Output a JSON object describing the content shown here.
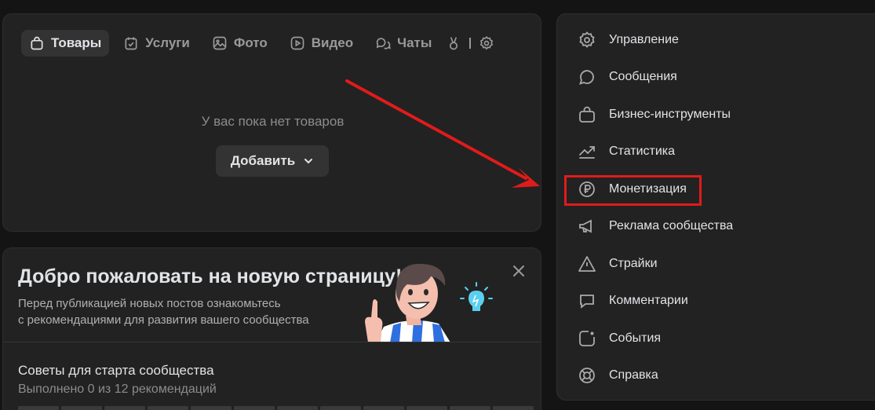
{
  "tabs": [
    {
      "label": "Товары",
      "icon": "bag-icon",
      "active": true
    },
    {
      "label": "Услуги",
      "icon": "calendar-check-icon"
    },
    {
      "label": "Фото",
      "icon": "image-icon"
    },
    {
      "label": "Видео",
      "icon": "play-icon"
    },
    {
      "label": "Чаты",
      "icon": "chats-icon"
    }
  ],
  "tabs_more": {
    "label": "l"
  },
  "products": {
    "empty_text": "У вас пока нет товаров",
    "add_label": "Добавить"
  },
  "welcome": {
    "title": "Добро пожаловать на новую страницу!",
    "desc_line1": "Перед публикацией новых постов ознакомьтесь",
    "desc_line2": "с рекомендациями для развития вашего сообщества",
    "tips_title": "Советы для старта сообщества",
    "tips_progress": "Выполнено 0 из 12 рекомендаций",
    "completed": 0,
    "total": 12
  },
  "menu": [
    {
      "label": "Управление",
      "icon": "gear-icon"
    },
    {
      "label": "Сообщения",
      "icon": "message-icon"
    },
    {
      "label": "Бизнес-инструменты",
      "icon": "briefcase-icon"
    },
    {
      "label": "Статистика",
      "icon": "trend-icon"
    },
    {
      "label": "Монетизация",
      "icon": "ruble-icon",
      "highlighted": true
    },
    {
      "label": "Реклама сообщества",
      "icon": "megaphone-icon"
    },
    {
      "label": "Страйки",
      "icon": "warning-icon"
    },
    {
      "label": "Комментарии",
      "icon": "comment-icon"
    },
    {
      "label": "События",
      "icon": "event-icon"
    },
    {
      "label": "Справка",
      "icon": "lifebuoy-icon"
    }
  ],
  "colors": {
    "background": "#141414",
    "card": "#222222",
    "highlight": "#e01b1b"
  }
}
